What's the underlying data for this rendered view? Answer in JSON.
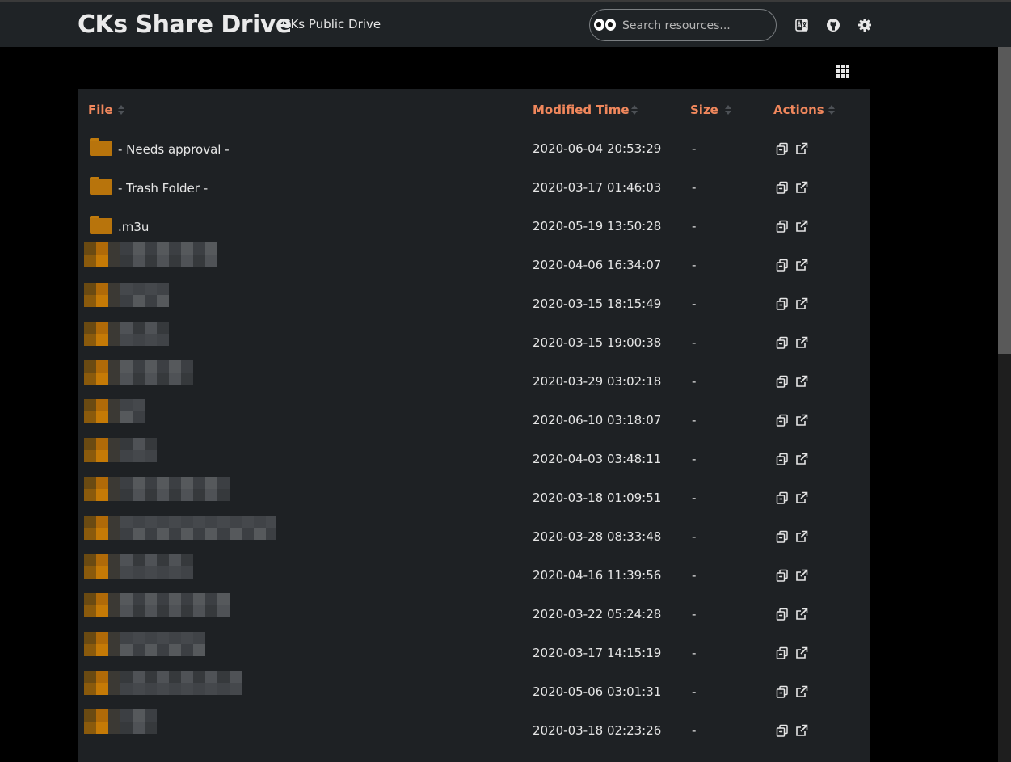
{
  "header": {
    "site_title": "CKs Share Drive",
    "subtitle": "CKs Public Drive",
    "search_placeholder": "Search resources...",
    "icons": [
      "translate-icon",
      "github-icon",
      "settings-gear-icon"
    ]
  },
  "view_toggle": {
    "icon": "grid-view-icon"
  },
  "table": {
    "columns": [
      "File",
      "Modified Time",
      "Size",
      "Actions"
    ],
    "accent_color": "#f0875c",
    "rows": [
      {
        "type": "folder",
        "name": "- Needs approval -",
        "modified": "2020-06-04 20:53:29",
        "size": "-"
      },
      {
        "type": "folder",
        "name": "- Trash Folder -",
        "modified": "2020-03-17 01:46:03",
        "size": "-"
      },
      {
        "type": "folder",
        "name": ".m3u",
        "modified": "2020-05-19 13:50:28",
        "size": "-"
      },
      {
        "type": "redacted",
        "name": "",
        "modified": "2020-04-06 16:34:07",
        "size": "-"
      },
      {
        "type": "redacted",
        "name": "",
        "modified": "2020-03-15 18:15:49",
        "size": "-"
      },
      {
        "type": "redacted",
        "name": "",
        "modified": "2020-03-15 19:00:38",
        "size": "-"
      },
      {
        "type": "redacted",
        "name": "",
        "modified": "2020-03-29 03:02:18",
        "size": "-"
      },
      {
        "type": "redacted",
        "name": "",
        "modified": "2020-06-10 03:18:07",
        "size": "-"
      },
      {
        "type": "redacted",
        "name": "",
        "modified": "2020-04-03 03:48:11",
        "size": "-"
      },
      {
        "type": "redacted",
        "name": "",
        "modified": "2020-03-18 01:09:51",
        "size": "-"
      },
      {
        "type": "redacted",
        "name": "",
        "modified": "2020-03-28 08:33:48",
        "size": "-"
      },
      {
        "type": "redacted",
        "name": "",
        "modified": "2020-04-16 11:39:56",
        "size": "-"
      },
      {
        "type": "redacted",
        "name": "",
        "modified": "2020-03-22 05:24:28",
        "size": "-"
      },
      {
        "type": "redacted",
        "name": "",
        "modified": "2020-03-17 14:15:19",
        "size": "-"
      },
      {
        "type": "redacted",
        "name": "",
        "modified": "2020-05-06 03:01:31",
        "size": "-"
      },
      {
        "type": "redacted",
        "name": "",
        "modified": "2020-03-18 02:23:26",
        "size": "-"
      }
    ],
    "row_actions": [
      "copy-link-icon",
      "open-external-icon"
    ]
  }
}
